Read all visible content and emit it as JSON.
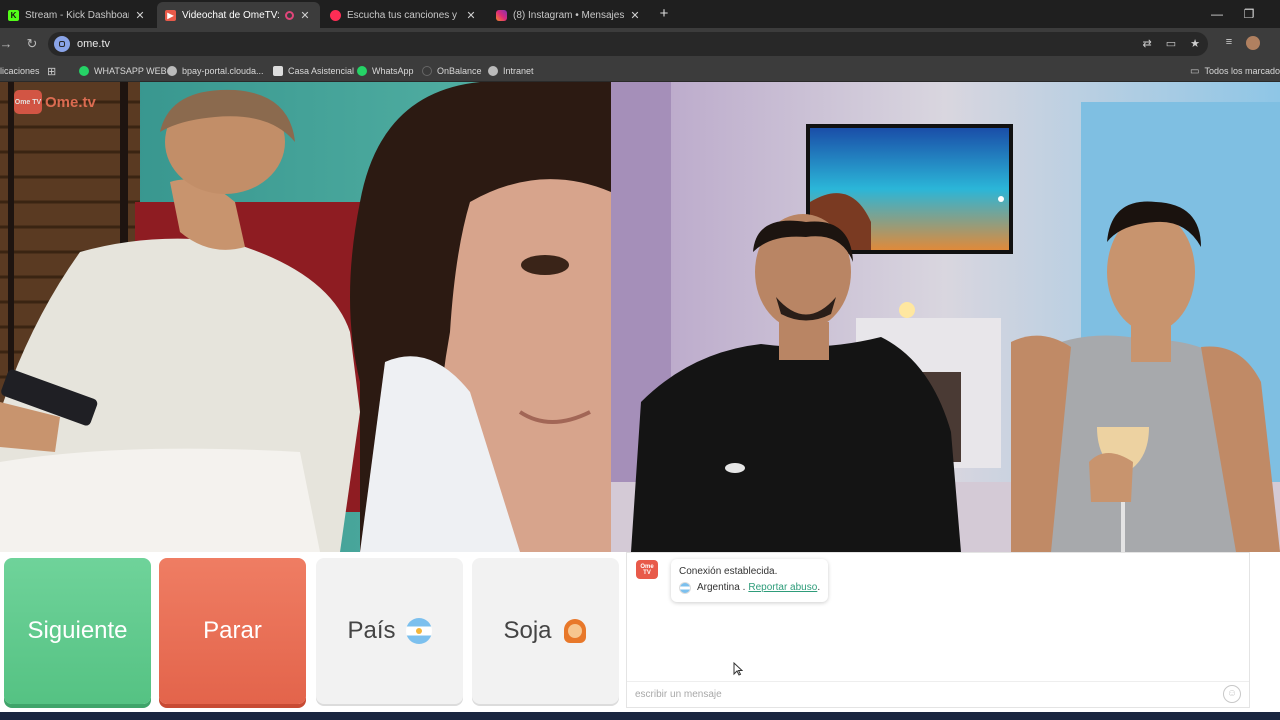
{
  "tabs": [
    {
      "title": "Stream - Kick Dashboard",
      "favicon": "kick-icon",
      "color": "#53fc18",
      "active": false
    },
    {
      "title": "Videochat de OmeTV: una a",
      "favicon": "ometv-icon",
      "color": "#e85a4a",
      "active": true,
      "recording": true
    },
    {
      "title": "Escucha tus canciones y álbum",
      "favicon": "music-icon",
      "color": "#ff2d55",
      "active": false
    },
    {
      "title": "(8) Instagram • Mensajes",
      "favicon": "instagram-icon",
      "color": "#d6249f",
      "active": false
    }
  ],
  "address": {
    "url": "ome.tv"
  },
  "bookmarks": [
    {
      "label": "licaciones"
    },
    {
      "label": "WHATSAPP WEB",
      "icon_color": "#25d366"
    },
    {
      "label": "bpay-portal.clouda...",
      "icon_color": "#bbbbbb"
    },
    {
      "label": "Casa Asistencial",
      "icon_color": "#dddddd"
    },
    {
      "label": "WhatsApp",
      "icon_color": "#25d366"
    },
    {
      "label": "OnBalance",
      "icon_color": "#3a3a3a"
    },
    {
      "label": "Intranet",
      "icon_color": "#bbbbbb"
    },
    {
      "label": "Todos los marcadores"
    }
  ],
  "app": {
    "logo_text": "Ome.tv",
    "logo_badge": "Ome TV",
    "buttons": {
      "next": "Siguiente",
      "stop": "Parar",
      "country": "País",
      "gender": "Soja"
    },
    "chat": {
      "status": "Conexión establecida.",
      "country": "Argentina .",
      "report": "Reportar abuso",
      "report_suffix": ".",
      "placeholder": "escribir un mensaje"
    }
  },
  "colors": {
    "next": "#55c283",
    "stop": "#e3644b",
    "accent": "#e85a4a"
  }
}
